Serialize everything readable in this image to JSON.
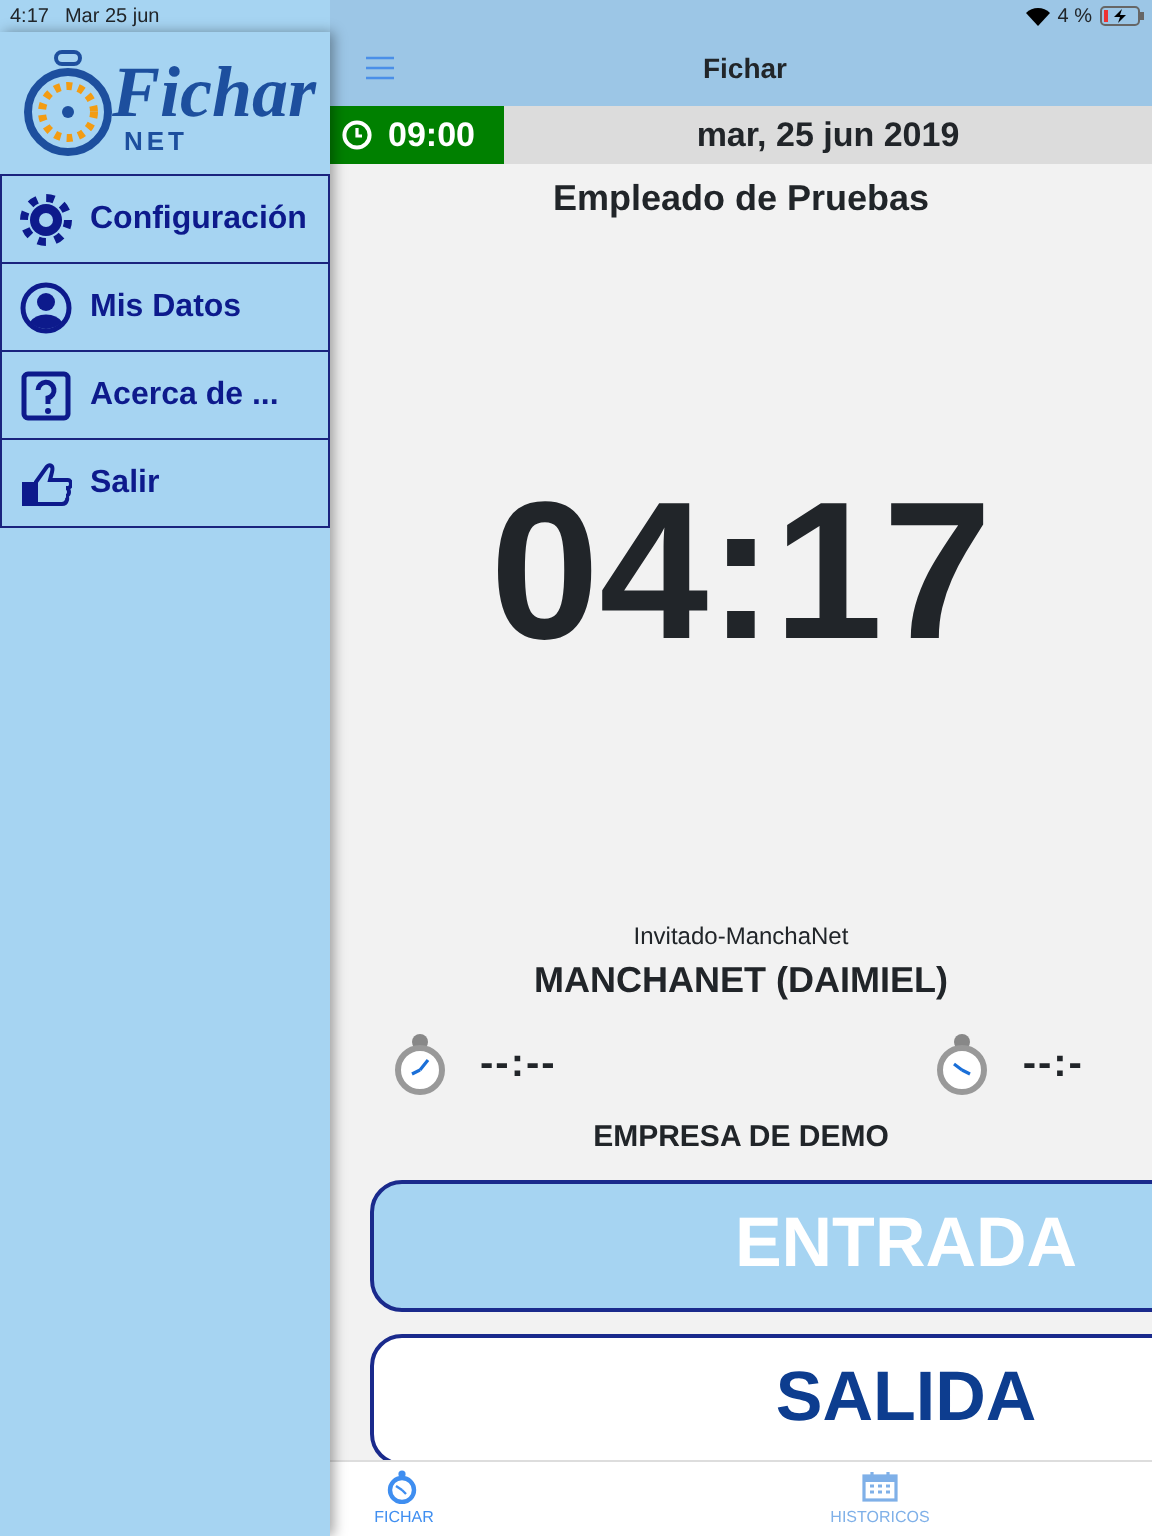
{
  "status_bar": {
    "time": "4:17",
    "date": "Mar 25 jun",
    "battery": "4 %"
  },
  "sidebar": {
    "logo": {
      "title": "Fichar",
      "subtitle": "NET"
    },
    "items": [
      {
        "label": "Configuración",
        "kind": "gear"
      },
      {
        "label": "Mis Datos",
        "kind": "user"
      },
      {
        "label": "Acerca de ...",
        "kind": "help"
      },
      {
        "label": "Salir",
        "kind": "thumb"
      }
    ]
  },
  "header": {
    "title": "Fichar"
  },
  "clock_bar": {
    "start_time": "09:00",
    "date": "mar, 25 jun 2019"
  },
  "employee": "Empleado de Pruebas",
  "current_time": "04:17",
  "location": {
    "group": "Invitado-ManchaNet",
    "name": "MANCHANET (DAIMIEL)"
  },
  "timers": [
    {
      "value": "--:--"
    },
    {
      "value": "--:-"
    }
  ],
  "company": "EMPRESA DE DEMO",
  "actions": [
    {
      "label": "ENTRADA",
      "kind": "filled"
    },
    {
      "label": "SALIDA",
      "kind": "outline"
    }
  ],
  "tabs": [
    {
      "label": "FICHAR",
      "kind": "stopwatch",
      "selected": true
    },
    {
      "label": "HISTORICOS",
      "kind": "calendar",
      "selected": false
    }
  ]
}
